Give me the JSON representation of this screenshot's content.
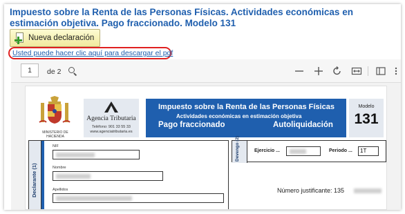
{
  "page": {
    "title": "Impuesto sobre la Renta de las Personas Físicas. Actividades económicas en estimación objetiva. Pago fraccionado. Modelo 131",
    "new_declaration_label": "Nueva declaración",
    "download_link": "Usted puede hacer clic aquí para descargar el pdf"
  },
  "viewer_toolbar": {
    "page_current": "1",
    "page_total": "de 2",
    "icons": [
      "search-icon",
      "zoom-out-icon",
      "zoom-in-icon",
      "rotate-icon",
      "fit-width-icon",
      "pages-icon",
      "more-icon"
    ]
  },
  "pdf": {
    "ministry": "MINISTERIO DE HACIENDA",
    "agency_name": "Agencia Tributaria",
    "agency_phone": "Teléfono: 901 33 55 33",
    "agency_web": "www.agenciatributaria.es",
    "banner_line1": "Impuesto sobre la Renta de las Personas Físicas",
    "banner_line2": "Actividades económicas en estimación objetiva",
    "banner_line3": "Pago fraccionado",
    "banner_line4": "Autoliquidación",
    "model_label": "Modelo",
    "model_number": "131",
    "declarante_label": "Declarante (1)",
    "nif_label": "NIF",
    "nombre_label": "Nombre",
    "apellidos_label": "Apellidos",
    "devengo_label": "Devengo (2)",
    "ejercicio_label": "Ejercicio ...",
    "periodo_label": "Periodo ...",
    "periodo_value": "1T",
    "justificante_label": "Número justificante: 135"
  },
  "colors": {
    "title_blue": "#1f5fae",
    "banner_blue": "#1f5fae",
    "highlight_red": "#e02020",
    "button_yellow": "#f1ea9e"
  }
}
